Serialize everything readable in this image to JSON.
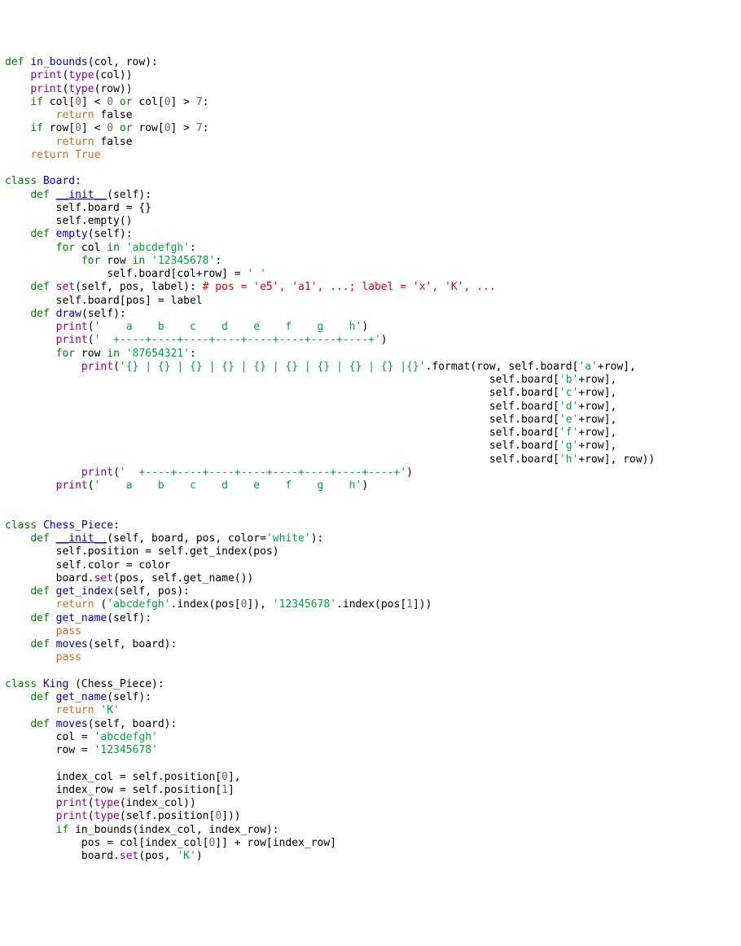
{
  "code": {
    "lines": [
      [
        {
          "t": "def ",
          "c": "keyword"
        },
        {
          "t": "in_bounds",
          "c": "funcname"
        },
        {
          "t": "(col, row):",
          "c": "plain"
        }
      ],
      [
        {
          "t": "    ",
          "c": "plain"
        },
        {
          "t": "print",
          "c": "builtin"
        },
        {
          "t": "(",
          "c": "plain"
        },
        {
          "t": "type",
          "c": "builtin"
        },
        {
          "t": "(col))",
          "c": "plain"
        }
      ],
      [
        {
          "t": "    ",
          "c": "plain"
        },
        {
          "t": "print",
          "c": "builtin"
        },
        {
          "t": "(",
          "c": "plain"
        },
        {
          "t": "type",
          "c": "builtin"
        },
        {
          "t": "(row))",
          "c": "plain"
        }
      ],
      [
        {
          "t": "    ",
          "c": "plain"
        },
        {
          "t": "if",
          "c": "keyword"
        },
        {
          "t": " col[",
          "c": "plain"
        },
        {
          "t": "0",
          "c": "number"
        },
        {
          "t": "] < ",
          "c": "plain"
        },
        {
          "t": "0",
          "c": "number"
        },
        {
          "t": " ",
          "c": "plain"
        },
        {
          "t": "or",
          "c": "keyword"
        },
        {
          "t": " col[",
          "c": "plain"
        },
        {
          "t": "0",
          "c": "number"
        },
        {
          "t": "] > ",
          "c": "plain"
        },
        {
          "t": "7",
          "c": "number"
        },
        {
          "t": ":",
          "c": "plain"
        }
      ],
      [
        {
          "t": "        ",
          "c": "plain"
        },
        {
          "t": "return",
          "c": "const"
        },
        {
          "t": " false",
          "c": "plain"
        }
      ],
      [
        {
          "t": "    ",
          "c": "plain"
        },
        {
          "t": "if",
          "c": "keyword"
        },
        {
          "t": " row[",
          "c": "plain"
        },
        {
          "t": "0",
          "c": "number"
        },
        {
          "t": "] < ",
          "c": "plain"
        },
        {
          "t": "0",
          "c": "number"
        },
        {
          "t": " ",
          "c": "plain"
        },
        {
          "t": "or",
          "c": "keyword"
        },
        {
          "t": " row[",
          "c": "plain"
        },
        {
          "t": "0",
          "c": "number"
        },
        {
          "t": "] > ",
          "c": "plain"
        },
        {
          "t": "7",
          "c": "number"
        },
        {
          "t": ":",
          "c": "plain"
        }
      ],
      [
        {
          "t": "        ",
          "c": "plain"
        },
        {
          "t": "return",
          "c": "const"
        },
        {
          "t": " false",
          "c": "plain"
        }
      ],
      [
        {
          "t": "    ",
          "c": "plain"
        },
        {
          "t": "return",
          "c": "const"
        },
        {
          "t": " ",
          "c": "plain"
        },
        {
          "t": "True",
          "c": "const"
        }
      ],
      [
        {
          "t": "",
          "c": "plain"
        }
      ],
      [
        {
          "t": "class ",
          "c": "keyword"
        },
        {
          "t": "Board",
          "c": "funcname"
        },
        {
          "t": ":",
          "c": "plain"
        }
      ],
      [
        {
          "t": "    ",
          "c": "plain"
        },
        {
          "t": "def ",
          "c": "keyword"
        },
        {
          "t": "__init__",
          "c": "funcname u"
        },
        {
          "t": "(self):",
          "c": "plain"
        }
      ],
      [
        {
          "t": "        self.board = {}",
          "c": "plain"
        }
      ],
      [
        {
          "t": "        self.empty()",
          "c": "plain"
        }
      ],
      [
        {
          "t": "    ",
          "c": "plain"
        },
        {
          "t": "def ",
          "c": "keyword"
        },
        {
          "t": "empty",
          "c": "funcname"
        },
        {
          "t": "(self):",
          "c": "plain"
        }
      ],
      [
        {
          "t": "        ",
          "c": "plain"
        },
        {
          "t": "for",
          "c": "keyword"
        },
        {
          "t": " col ",
          "c": "plain"
        },
        {
          "t": "in",
          "c": "keyword"
        },
        {
          "t": " ",
          "c": "plain"
        },
        {
          "t": "'abcdefgh'",
          "c": "string"
        },
        {
          "t": ":",
          "c": "plain"
        }
      ],
      [
        {
          "t": "            ",
          "c": "plain"
        },
        {
          "t": "for",
          "c": "keyword"
        },
        {
          "t": " row ",
          "c": "plain"
        },
        {
          "t": "in",
          "c": "keyword"
        },
        {
          "t": " ",
          "c": "plain"
        },
        {
          "t": "'12345678'",
          "c": "string"
        },
        {
          "t": ":",
          "c": "plain"
        }
      ],
      [
        {
          "t": "                self.board[col+row] = ",
          "c": "plain"
        },
        {
          "t": "' '",
          "c": "string"
        }
      ],
      [
        {
          "t": "    ",
          "c": "plain"
        },
        {
          "t": "def ",
          "c": "keyword"
        },
        {
          "t": "set",
          "c": "builtin"
        },
        {
          "t": "(self, pos, label): ",
          "c": "plain"
        },
        {
          "t": "# pos = 'e5', 'a1', ...; label = 'x', 'K', ...",
          "c": "comment"
        }
      ],
      [
        {
          "t": "        self.board[pos] = label",
          "c": "plain"
        }
      ],
      [
        {
          "t": "    ",
          "c": "plain"
        },
        {
          "t": "def ",
          "c": "keyword"
        },
        {
          "t": "draw",
          "c": "funcname"
        },
        {
          "t": "(self):",
          "c": "plain"
        }
      ],
      [
        {
          "t": "        ",
          "c": "plain"
        },
        {
          "t": "print",
          "c": "builtin"
        },
        {
          "t": "(",
          "c": "plain"
        },
        {
          "t": "'    a    b    c    d    e    f    g    h'",
          "c": "string"
        },
        {
          "t": ")",
          "c": "plain"
        }
      ],
      [
        {
          "t": "        ",
          "c": "plain"
        },
        {
          "t": "print",
          "c": "builtin"
        },
        {
          "t": "(",
          "c": "plain"
        },
        {
          "t": "'  +----+----+----+----+----+----+----+----+'",
          "c": "string"
        },
        {
          "t": ")",
          "c": "plain"
        }
      ],
      [
        {
          "t": "        ",
          "c": "plain"
        },
        {
          "t": "for",
          "c": "keyword"
        },
        {
          "t": " row ",
          "c": "plain"
        },
        {
          "t": "in",
          "c": "keyword"
        },
        {
          "t": " ",
          "c": "plain"
        },
        {
          "t": "'87654321'",
          "c": "string"
        },
        {
          "t": ":",
          "c": "plain"
        }
      ],
      [
        {
          "t": "            ",
          "c": "plain"
        },
        {
          "t": "print",
          "c": "builtin"
        },
        {
          "t": "(",
          "c": "plain"
        },
        {
          "t": "'{} | {} | {} | {} | {} | {} | {} | {} | {} |{}'",
          "c": "string"
        },
        {
          "t": ".format(row, self.board[",
          "c": "plain"
        },
        {
          "t": "'a'",
          "c": "string"
        },
        {
          "t": "+row],",
          "c": "plain"
        }
      ],
      [
        {
          "t": "                                                                            self.board[",
          "c": "plain"
        },
        {
          "t": "'b'",
          "c": "string"
        },
        {
          "t": "+row],",
          "c": "plain"
        }
      ],
      [
        {
          "t": "                                                                            self.board[",
          "c": "plain"
        },
        {
          "t": "'c'",
          "c": "string"
        },
        {
          "t": "+row],",
          "c": "plain"
        }
      ],
      [
        {
          "t": "                                                                            self.board[",
          "c": "plain"
        },
        {
          "t": "'d'",
          "c": "string"
        },
        {
          "t": "+row],",
          "c": "plain"
        }
      ],
      [
        {
          "t": "                                                                            self.board[",
          "c": "plain"
        },
        {
          "t": "'e'",
          "c": "string"
        },
        {
          "t": "+row],",
          "c": "plain"
        }
      ],
      [
        {
          "t": "                                                                            self.board[",
          "c": "plain"
        },
        {
          "t": "'f'",
          "c": "string"
        },
        {
          "t": "+row],",
          "c": "plain"
        }
      ],
      [
        {
          "t": "                                                                            self.board[",
          "c": "plain"
        },
        {
          "t": "'g'",
          "c": "string"
        },
        {
          "t": "+row],",
          "c": "plain"
        }
      ],
      [
        {
          "t": "                                                                            self.board[",
          "c": "plain"
        },
        {
          "t": "'h'",
          "c": "string"
        },
        {
          "t": "+row], row))",
          "c": "plain"
        }
      ],
      [
        {
          "t": "            ",
          "c": "plain"
        },
        {
          "t": "print",
          "c": "builtin"
        },
        {
          "t": "(",
          "c": "plain"
        },
        {
          "t": "'  +----+----+----+----+----+----+----+----+'",
          "c": "string"
        },
        {
          "t": ")",
          "c": "plain"
        }
      ],
      [
        {
          "t": "        ",
          "c": "plain"
        },
        {
          "t": "print",
          "c": "builtin"
        },
        {
          "t": "(",
          "c": "plain"
        },
        {
          "t": "'    a    b    c    d    e    f    g    h'",
          "c": "string"
        },
        {
          "t": ")",
          "c": "plain"
        }
      ],
      [
        {
          "t": "",
          "c": "plain"
        }
      ],
      [
        {
          "t": "",
          "c": "plain"
        }
      ],
      [
        {
          "t": "class ",
          "c": "keyword"
        },
        {
          "t": "Chess_Piece",
          "c": "funcname"
        },
        {
          "t": ":",
          "c": "plain"
        }
      ],
      [
        {
          "t": "    ",
          "c": "plain"
        },
        {
          "t": "def ",
          "c": "keyword"
        },
        {
          "t": "__init__",
          "c": "funcname u"
        },
        {
          "t": "(self, board, pos, color=",
          "c": "plain"
        },
        {
          "t": "'white'",
          "c": "string"
        },
        {
          "t": "):",
          "c": "plain"
        }
      ],
      [
        {
          "t": "        self.position = self.get_index(pos)",
          "c": "plain"
        }
      ],
      [
        {
          "t": "        self.color = color",
          "c": "plain"
        }
      ],
      [
        {
          "t": "        board.",
          "c": "plain"
        },
        {
          "t": "set",
          "c": "builtin"
        },
        {
          "t": "(pos, self.get_name())",
          "c": "plain"
        }
      ],
      [
        {
          "t": "    ",
          "c": "plain"
        },
        {
          "t": "def ",
          "c": "keyword"
        },
        {
          "t": "get_index",
          "c": "funcname"
        },
        {
          "t": "(self, pos):",
          "c": "plain"
        }
      ],
      [
        {
          "t": "        ",
          "c": "plain"
        },
        {
          "t": "return",
          "c": "const"
        },
        {
          "t": " (",
          "c": "plain"
        },
        {
          "t": "'abcdefgh'",
          "c": "string"
        },
        {
          "t": ".index(pos[",
          "c": "plain"
        },
        {
          "t": "0",
          "c": "number"
        },
        {
          "t": "]), ",
          "c": "plain"
        },
        {
          "t": "'12345678'",
          "c": "string"
        },
        {
          "t": ".index(pos[",
          "c": "plain"
        },
        {
          "t": "1",
          "c": "number"
        },
        {
          "t": "]))",
          "c": "plain"
        }
      ],
      [
        {
          "t": "    ",
          "c": "plain"
        },
        {
          "t": "def ",
          "c": "keyword"
        },
        {
          "t": "get_name",
          "c": "funcname"
        },
        {
          "t": "(self):",
          "c": "plain"
        }
      ],
      [
        {
          "t": "        ",
          "c": "plain"
        },
        {
          "t": "pass",
          "c": "const"
        }
      ],
      [
        {
          "t": "    ",
          "c": "plain"
        },
        {
          "t": "def ",
          "c": "keyword"
        },
        {
          "t": "moves",
          "c": "funcname"
        },
        {
          "t": "(self, board):",
          "c": "plain"
        }
      ],
      [
        {
          "t": "        ",
          "c": "plain"
        },
        {
          "t": "pass",
          "c": "const"
        }
      ],
      [
        {
          "t": "",
          "c": "plain"
        }
      ],
      [
        {
          "t": "class ",
          "c": "keyword"
        },
        {
          "t": "King",
          "c": "funcname"
        },
        {
          "t": " (Chess_Piece):",
          "c": "plain"
        }
      ],
      [
        {
          "t": "    ",
          "c": "plain"
        },
        {
          "t": "def ",
          "c": "keyword"
        },
        {
          "t": "get_name",
          "c": "funcname"
        },
        {
          "t": "(self):",
          "c": "plain"
        }
      ],
      [
        {
          "t": "        ",
          "c": "plain"
        },
        {
          "t": "return",
          "c": "const"
        },
        {
          "t": " ",
          "c": "plain"
        },
        {
          "t": "'K'",
          "c": "string"
        }
      ],
      [
        {
          "t": "    ",
          "c": "plain"
        },
        {
          "t": "def ",
          "c": "keyword"
        },
        {
          "t": "moves",
          "c": "funcname"
        },
        {
          "t": "(self, board):",
          "c": "plain"
        }
      ],
      [
        {
          "t": "        col = ",
          "c": "plain"
        },
        {
          "t": "'abcdefgh'",
          "c": "string"
        }
      ],
      [
        {
          "t": "        row = ",
          "c": "plain"
        },
        {
          "t": "'12345678'",
          "c": "string"
        }
      ],
      [
        {
          "t": "",
          "c": "plain"
        }
      ],
      [
        {
          "t": "        index_col = self.position[",
          "c": "plain"
        },
        {
          "t": "0",
          "c": "number"
        },
        {
          "t": "],",
          "c": "plain"
        }
      ],
      [
        {
          "t": "        index_row = self.position[",
          "c": "plain"
        },
        {
          "t": "1",
          "c": "number"
        },
        {
          "t": "]",
          "c": "plain"
        }
      ],
      [
        {
          "t": "        ",
          "c": "plain"
        },
        {
          "t": "print",
          "c": "builtin"
        },
        {
          "t": "(",
          "c": "plain"
        },
        {
          "t": "type",
          "c": "builtin"
        },
        {
          "t": "(index_col))",
          "c": "plain"
        }
      ],
      [
        {
          "t": "        ",
          "c": "plain"
        },
        {
          "t": "print",
          "c": "builtin"
        },
        {
          "t": "(",
          "c": "plain"
        },
        {
          "t": "type",
          "c": "builtin"
        },
        {
          "t": "(self.position[",
          "c": "plain"
        },
        {
          "t": "0",
          "c": "number"
        },
        {
          "t": "]))",
          "c": "plain"
        }
      ],
      [
        {
          "t": "        ",
          "c": "plain"
        },
        {
          "t": "if",
          "c": "keyword"
        },
        {
          "t": " in_bounds(index_col, index_row):",
          "c": "plain"
        }
      ],
      [
        {
          "t": "            pos = col[index_col[",
          "c": "plain"
        },
        {
          "t": "0",
          "c": "number"
        },
        {
          "t": "]] + row[index_row]",
          "c": "plain"
        }
      ],
      [
        {
          "t": "            board.",
          "c": "plain"
        },
        {
          "t": "set",
          "c": "builtin"
        },
        {
          "t": "(pos, ",
          "c": "plain"
        },
        {
          "t": "'K'",
          "c": "string"
        },
        {
          "t": ")",
          "c": "plain"
        }
      ],
      [
        {
          "t": "",
          "c": "plain"
        }
      ]
    ]
  }
}
